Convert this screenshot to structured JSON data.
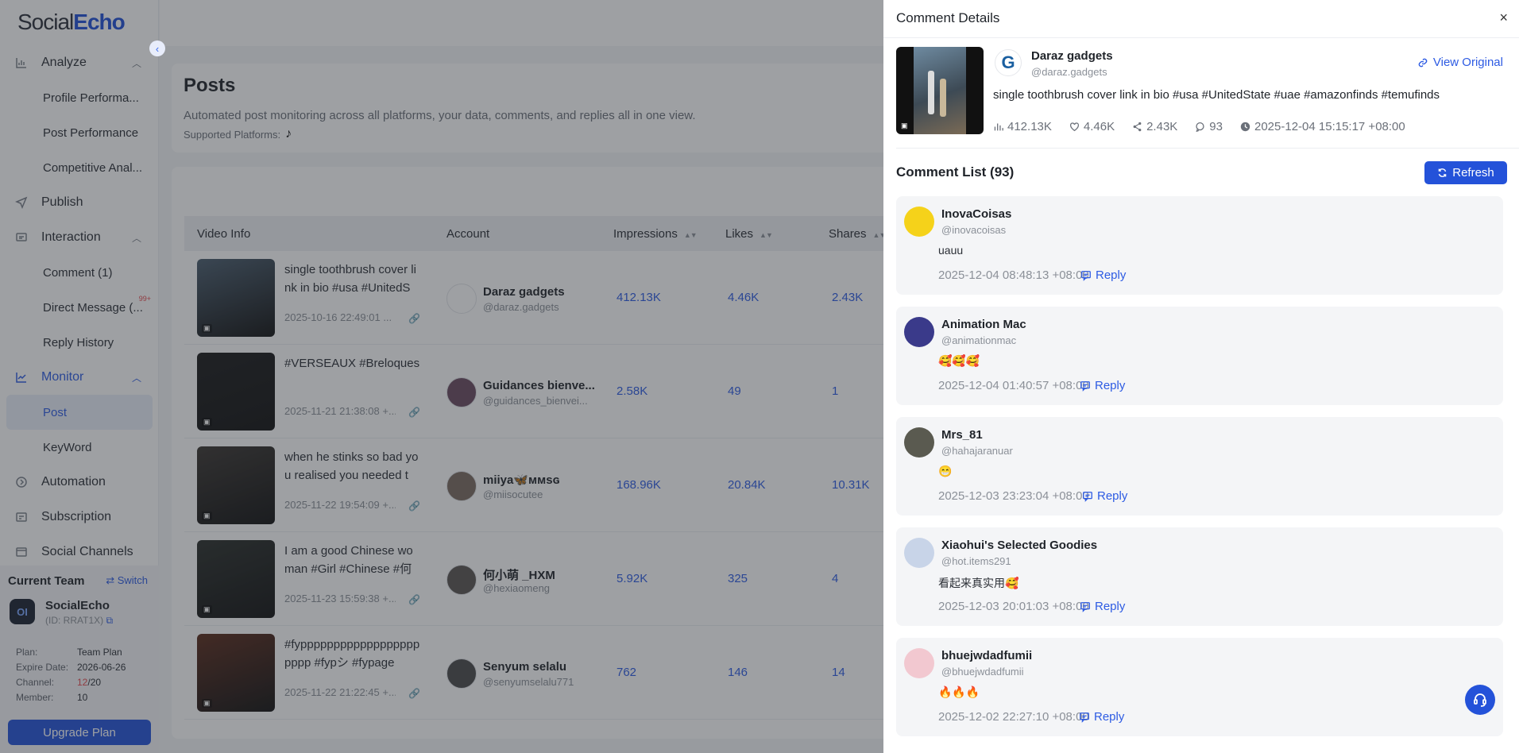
{
  "sidebar": {
    "logo_prefix": "Social",
    "logo_suffix": "Echo",
    "nav": {
      "analyze": "Analyze",
      "profile_performance": "Profile Performa...",
      "post_performance": "Post Performance",
      "competitive": "Competitive Anal...",
      "publish": "Publish",
      "interaction": "Interaction",
      "comment": "Comment (1)",
      "direct_message": "Direct Message (...",
      "dm_badge": "99+",
      "reply_history": "Reply History",
      "monitor": "Monitor",
      "post": "Post",
      "keyword": "KeyWord",
      "automation": "Automation",
      "subscription": "Subscription",
      "social_channels": "Social Channels"
    },
    "team": {
      "title": "Current Team",
      "switch": "Switch",
      "logo_text": "OI",
      "name": "SocialEcho",
      "id": "(ID: RRAT1X)",
      "plan_label": "Plan:",
      "plan_value": "Team Plan",
      "expire_label": "Expire Date:",
      "expire_value": "2026-06-26",
      "channel_label": "Channel:",
      "channel_used": "12",
      "channel_total": "/20",
      "member_label": "Member:",
      "member_value": "10",
      "upgrade": "Upgrade Plan"
    }
  },
  "posts": {
    "title": "Posts",
    "desc": "Automated post monitoring across all platforms, your data, comments, and replies all in one view.",
    "supported": "Supported Platforms:",
    "columns": {
      "video": "Video Info",
      "account": "Account",
      "impressions": "Impressions",
      "likes": "Likes",
      "shares": "Shares"
    },
    "rows": [
      {
        "text": "single toothbrush cover link in bio #usa #UnitedSt...",
        "date": "2025-10-16 22:49:01 ...",
        "name": "Daraz gadgets",
        "handle": "@daraz.gadgets",
        "impressions": "412.13K",
        "likes": "4.46K",
        "shares": "2.43K",
        "thumb_color": "#4a5d6e",
        "av_color": "#ffffff"
      },
      {
        "text": "#VERSEAUX #Breloques",
        "date": "2025-11-21 21:38:08 +...",
        "name": "Guidances bienve...",
        "handle": "@guidances_bienvei...",
        "impressions": "2.58K",
        "likes": "49",
        "shares": "1",
        "thumb_color": "#1a1a1a",
        "av_color": "#6a4a60"
      },
      {
        "text": "when he stinks so bad you realised you needed to...",
        "date": "2025-11-22 19:54:09 +...",
        "name": "miiya🦋ᴍᴍsɢ",
        "handle": "@miisocutee",
        "impressions": "168.96K",
        "likes": "20.84K",
        "shares": "10.31K",
        "thumb_color": "#3a3530",
        "av_color": "#7a6a60"
      },
      {
        "text": "I am a good Chinese woman #Girl #Chinese #何小...",
        "date": "2025-11-23 15:59:38 +...",
        "name": "何小萌 _HXM",
        "handle": "@hexiaomeng",
        "impressions": "5.92K",
        "likes": "325",
        "shares": "4",
        "thumb_color": "#2a2e2a",
        "av_color": "#5a5450"
      },
      {
        "text": "#fypppppppppppppppppppppp #fypシ #fypage",
        "date": "2025-11-22 21:22:45 +...",
        "name": "Senyum selalu",
        "handle": "@senyumselalu771",
        "impressions": "762",
        "likes": "146",
        "shares": "14",
        "thumb_color": "#5a2a1a",
        "av_color": "#4a4a4a"
      }
    ]
  },
  "drawer": {
    "title": "Comment Details",
    "close": "×",
    "post_name": "Daraz gadgets",
    "post_handle": "@daraz.gadgets",
    "view_original": "View Original",
    "post_text": "single toothbrush cover link in bio #usa #UnitedState #uae #amazonfinds #temufinds",
    "stats": {
      "impressions": "412.13K",
      "likes": "4.46K",
      "shares": "2.43K",
      "comments": "93",
      "time": "2025-12-04 15:15:17 +08:00"
    },
    "list_title": "Comment List (93)",
    "refresh": "Refresh",
    "comments": [
      {
        "name": "InovaCoisas",
        "handle": "@inovacoisas",
        "text": "uauu",
        "time": "2025-12-04 08:48:13 +08:00",
        "reply": "Reply",
        "av_color": "#f5d21a"
      },
      {
        "name": "Animation Mac",
        "handle": "@animationmac",
        "text": "🥰🥰🥰",
        "time": "2025-12-04 01:40:57 +08:00",
        "reply": "Reply",
        "av_color": "#3a3a8a"
      },
      {
        "name": "Mrs_81",
        "handle": "@hahajaranuar",
        "text": "😁",
        "time": "2025-12-03 23:23:04 +08:00",
        "reply": "Reply",
        "av_color": "#5a5a50"
      },
      {
        "name": "Xiaohui's Selected Goodies",
        "handle": "@hot.items291",
        "text": "看起来真实用🥰",
        "time": "2025-12-03 20:01:03 +08:00",
        "reply": "Reply",
        "av_color": "#c8d4e8"
      },
      {
        "name": "bhuejwdadfumii",
        "handle": "@bhuejwdadfumii",
        "text": "🔥🔥🔥",
        "time": "2025-12-02 22:27:10 +08:00",
        "reply": "Reply",
        "av_color": "#f2c8d0"
      }
    ]
  },
  "colors": {
    "accent": "#2452d9",
    "link": "#2d5be3",
    "badge": "#e5484d"
  }
}
